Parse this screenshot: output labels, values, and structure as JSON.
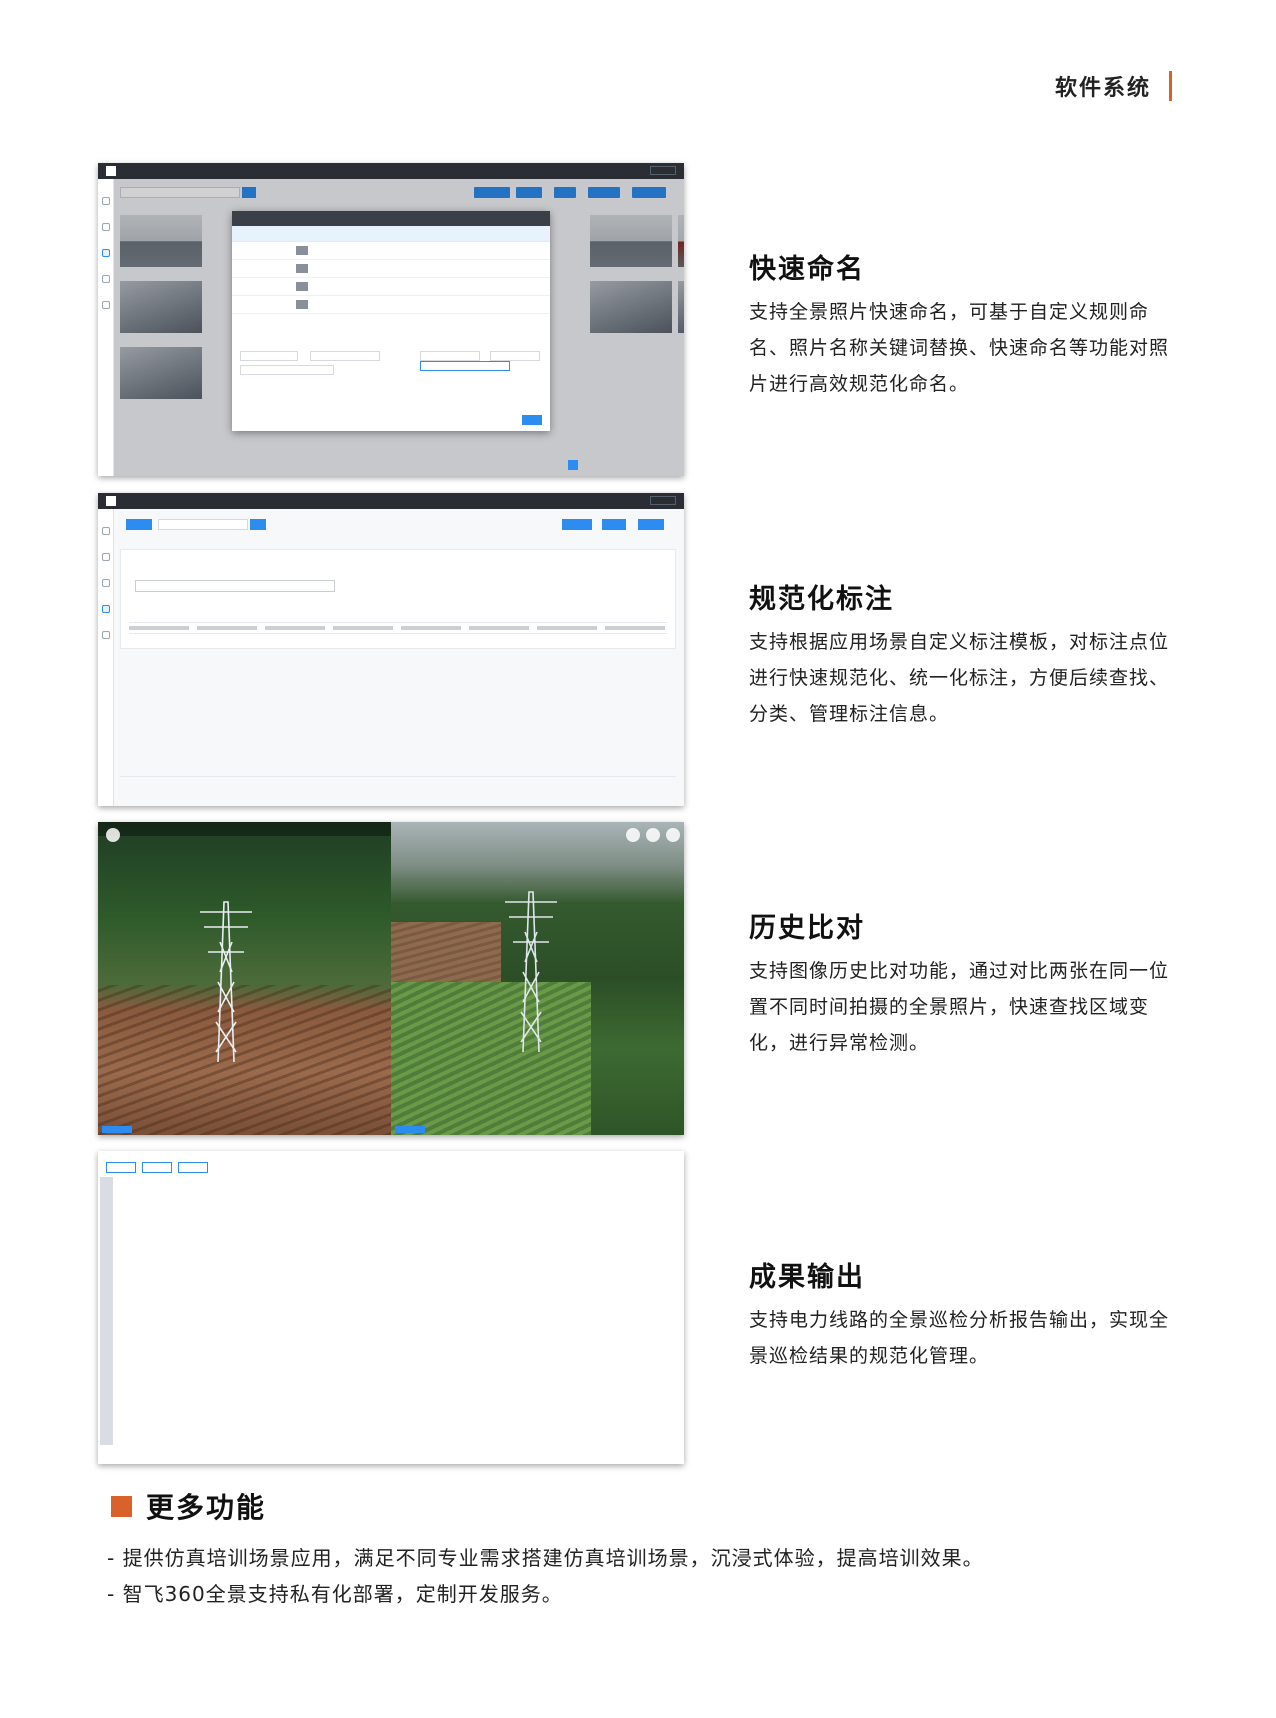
{
  "header": {
    "title": "软件系统"
  },
  "features": [
    {
      "title": "快速命名",
      "desc": "支持全景照片快速命名，可基于自定义规则命名、照片名称关键词替换、快速命名等功能对照片进行高效规范化命名。"
    },
    {
      "title": "规范化标注",
      "desc": "支持根据应用场景自定义标注模板，对标注点位进行快速规范化、统一化标注，方便后续查找、分类、管理标注信息。"
    },
    {
      "title": "历史比对",
      "desc": "支持图像历史比对功能，通过对比两张在同一位置不同时间拍摄的全景照片，快速查找区域变化，进行异常检测。"
    },
    {
      "title": "成果输出",
      "desc": "支持电力线路的全景巡检分析报告输出，实现全景巡检结果的规范化管理。"
    }
  ],
  "more": {
    "title": "更多功能",
    "items": [
      "- 提供仿真培训场景应用，满足不同专业需求搭建仿真培训场景，沉浸式体验，提高培训效果。",
      "- 智飞360全景支持私有化部署，定制开发服务。"
    ]
  },
  "colors": {
    "accent": "#d9622b",
    "ui_blue": "#2d8cf0"
  }
}
